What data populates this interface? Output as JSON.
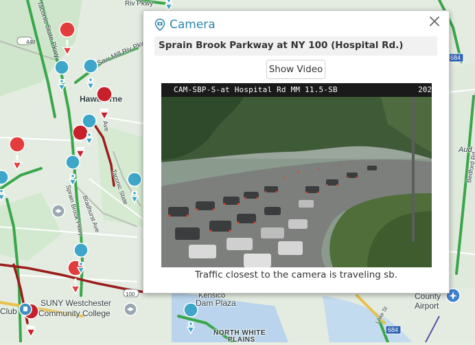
{
  "map": {
    "labels": {
      "hawthorne": "Hawthorne",
      "saw_mill_riv_pkwy": "Saw Mill Riv Pkwy",
      "sprain_brook_pkwy": "Sprain Brook Pkwy",
      "bradhurst_ave": "Bradhurst Ave",
      "taconic_state": "Taconic State",
      "taconic_state_pkwy_top": "Taconic State Pkwy",
      "bedford_rd": "Bedford Rd",
      "aud": "Aud",
      "suny_westchester": "SUNY Westchester",
      "community_college": "Community College",
      "club": "Club",
      "dam_plaza": "Dam Plaza",
      "north_white": "NORTH WHITE",
      "plains": "PLAINS",
      "county": "County",
      "airport": "Airport",
      "route_448": "448",
      "route_100": "100",
      "route_684_top": "684",
      "route_684_bottom": "684",
      "rd": "Rd",
      "kensico": "Kensico",
      "ave_rd": "Ave",
      "lake_st": "Lake St",
      "riv_pkwy_top": "Riv Pkwy"
    }
  },
  "popup": {
    "title": "Camera",
    "location": "Sprain Brook Parkway at NY 100 (Hospital Rd.)",
    "show_video_label": "Show Video",
    "camera_overlay_id": "CAM-SBP-S-at Hospital Rd MM 11.5-SB",
    "camera_overlay_year": "202",
    "caption": "Traffic closest to the camera is traveling sb."
  },
  "colors": {
    "accent": "#2a86a8",
    "camera_marker": "#3ea6c8",
    "incident_red": "#d6202b",
    "road_red": "#9b1c1c",
    "road_green": "#3aa64a",
    "road_yellow": "#e8c14a"
  }
}
